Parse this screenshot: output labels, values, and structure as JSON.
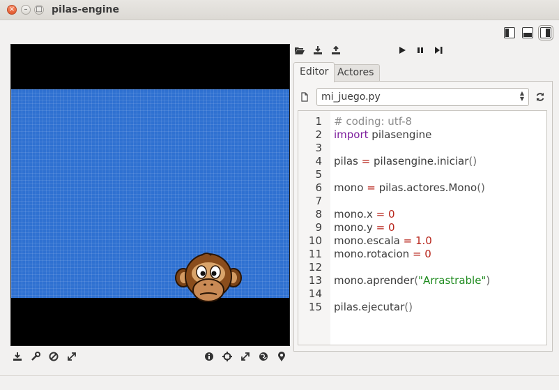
{
  "window": {
    "title": "pilas-engine",
    "controls": {
      "close": "×",
      "minimize": "–",
      "maximize": "□"
    }
  },
  "layout_buttons": [
    "layout-left-icon",
    "layout-bottom-icon",
    "layout-right-icon"
  ],
  "toolbar": {
    "icons": [
      "folder-open-icon",
      "download-icon",
      "upload-icon"
    ],
    "run_icons": [
      "play-icon",
      "pause-icon",
      "step-icon"
    ]
  },
  "tabs": [
    {
      "label": "Editor",
      "active": true
    },
    {
      "label": "Actores",
      "active": false
    }
  ],
  "file": {
    "selected": "mi_juego.py",
    "spinner_up": "▲",
    "spinner_down": "▼"
  },
  "code": {
    "line_numbers": [
      "1",
      "2",
      "3",
      "4",
      "5",
      "6",
      "7",
      "8",
      "9",
      "10",
      "11",
      "12",
      "13",
      "14",
      "15"
    ],
    "lines": [
      [
        {
          "t": "# coding: utf-8",
          "c": "cm"
        }
      ],
      [
        {
          "t": "import",
          "c": "kw"
        },
        {
          "t": " pilasengine",
          "c": ""
        }
      ],
      [],
      [
        {
          "t": "pilas ",
          "c": ""
        },
        {
          "t": "=",
          "c": "op"
        },
        {
          "t": " pilasengine.iniciar",
          "c": ""
        },
        {
          "t": "()",
          "c": "par"
        }
      ],
      [],
      [
        {
          "t": "mono ",
          "c": ""
        },
        {
          "t": "=",
          "c": "op"
        },
        {
          "t": " pilas.actores.Mono",
          "c": ""
        },
        {
          "t": "()",
          "c": "par"
        }
      ],
      [],
      [
        {
          "t": "mono.x ",
          "c": ""
        },
        {
          "t": "=",
          "c": "op"
        },
        {
          "t": " ",
          "c": ""
        },
        {
          "t": "0",
          "c": "num"
        }
      ],
      [
        {
          "t": "mono.y ",
          "c": ""
        },
        {
          "t": "=",
          "c": "op"
        },
        {
          "t": " ",
          "c": ""
        },
        {
          "t": "0",
          "c": "num"
        }
      ],
      [
        {
          "t": "mono.escala ",
          "c": ""
        },
        {
          "t": "=",
          "c": "op"
        },
        {
          "t": " ",
          "c": ""
        },
        {
          "t": "1.0",
          "c": "num"
        }
      ],
      [
        {
          "t": "mono.rotacion ",
          "c": ""
        },
        {
          "t": "=",
          "c": "op"
        },
        {
          "t": " ",
          "c": ""
        },
        {
          "t": "0",
          "c": "num"
        }
      ],
      [],
      [
        {
          "t": "mono.aprender",
          "c": ""
        },
        {
          "t": "(",
          "c": "par"
        },
        {
          "t": "\"Arrastrable\"",
          "c": "str"
        },
        {
          "t": ")",
          "c": "par"
        }
      ],
      [],
      [
        {
          "t": "pilas.ejecutar",
          "c": ""
        },
        {
          "t": "()",
          "c": "par"
        }
      ]
    ]
  },
  "canvas": {
    "stage_color": "#2f71d1",
    "bottom_left_icons": [
      "download-icon",
      "wrench-icon",
      "no-entry-icon",
      "expand-icon"
    ],
    "bottom_right_icons": [
      "info-icon",
      "crosshair-icon",
      "resize-icon",
      "globe-icon",
      "location-pin-icon"
    ]
  }
}
